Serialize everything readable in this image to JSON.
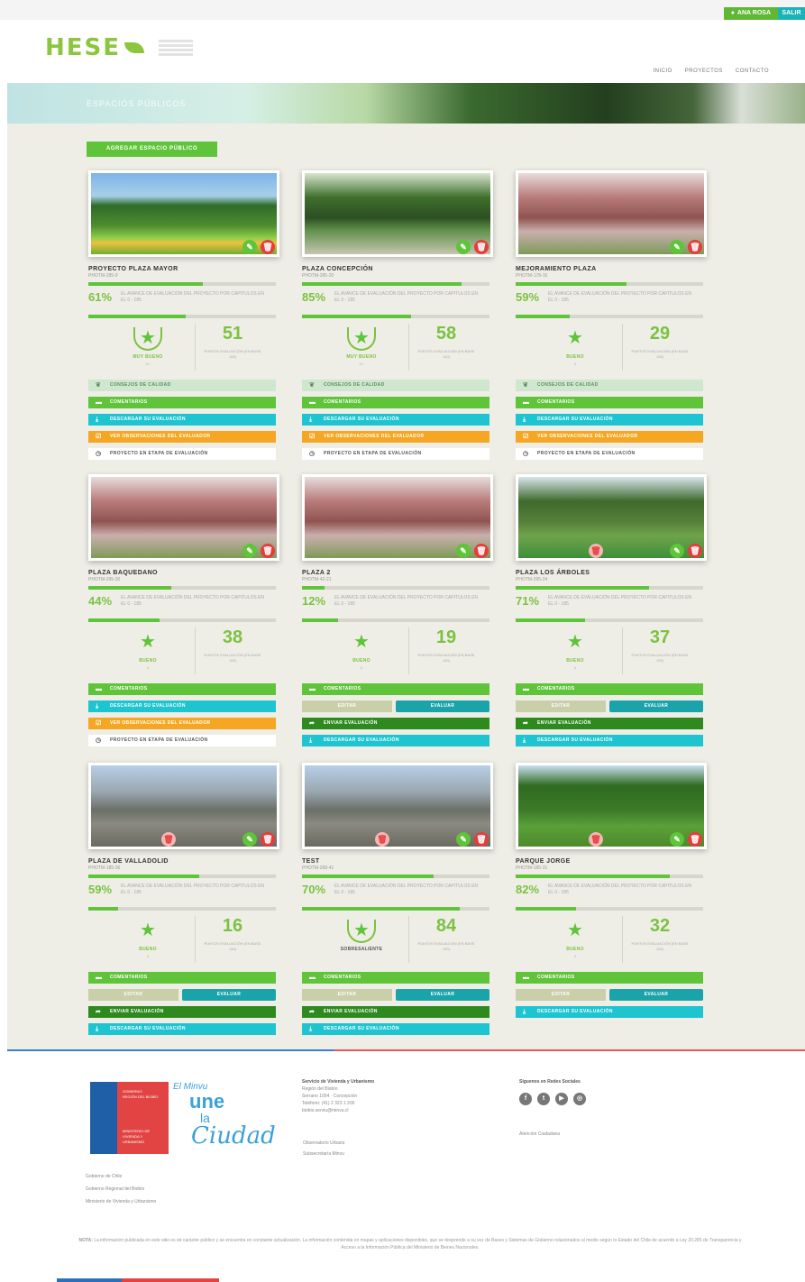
{
  "topbar": {
    "user_label": "ANA ROSA",
    "exit_label": "SALIR"
  },
  "header": {
    "logo_text": "HESE",
    "nav": [
      "INICIO",
      "PROYECTOS",
      "CONTACTO"
    ]
  },
  "banner": {
    "title": "ESPACIOS PÚBLICOS"
  },
  "add_button_label": "AGREGAR ESPACIO PÚBLICO",
  "cards": [
    {
      "title": "PROYECTO PLAZA MAYOR",
      "code": "PHOTM-285-9",
      "percent": "61%",
      "progress": 0.61,
      "progress2": 0.52,
      "pct_desc": "EL AVANCE DE EVALUACIÓN DEL PROYECTO POR CAPITULOS EN EL 0 - 185",
      "rating": "MUY BUENO",
      "rating_sub": "A+",
      "score": "51",
      "score_label": "PUNTOS EVALUACIÓN (EN BASE 100)",
      "advice_label": "CONSEJOS DE CALIDAD",
      "comments_label": "COMENTARIOS",
      "download_label": "DESCARGAR SU EVALUACIÓN",
      "observations_label": "VER OBSERVACIONES DEL EVALUADOR",
      "status_label": "PROYECTO EN ETAPA DE EVALUACIÓN"
    },
    {
      "title": "PLAZA CONCEPCIÓN",
      "code": "PHOTM-285-20",
      "percent": "85%",
      "progress": 0.85,
      "progress2": 0.58,
      "pct_desc": "EL AVANCE DE EVALUACIÓN DEL PROYECTO POR CAPITULOS EN EL 0 - 185",
      "rating": "MUY BUENO",
      "rating_sub": "A+",
      "score": "58",
      "score_label": "PUNTOS EVALUACIÓN (EN BASE 100)",
      "advice_label": "CONSEJOS DE CALIDAD",
      "comments_label": "COMENTARIOS",
      "download_label": "DESCARGAR SU EVALUACIÓN",
      "observations_label": "VER OBSERVACIONES DEL EVALUADOR",
      "status_label": "PROYECTO EN ETAPA DE EVALUACIÓN"
    },
    {
      "title": "MEJORAMIENTO PLAZA",
      "code": "PHOTM-178-16",
      "percent": "59%",
      "progress": 0.59,
      "progress2": 0.29,
      "pct_desc": "EL AVANCE DE EVALUACIÓN DEL PROYECTO POR CAPITULOS EN EL 0 - 185",
      "rating": "BUENO",
      "rating_sub": "A",
      "score": "29",
      "score_label": "PUNTOS EVALUACIÓN (EN BASE 100)",
      "advice_label": "CONSEJOS DE CALIDAD",
      "comments_label": "COMENTARIOS",
      "download_label": "DESCARGAR SU EVALUACIÓN",
      "observations_label": "VER OBSERVACIONES DEL EVALUADOR",
      "status_label": "PROYECTO EN ETAPA DE EVALUACIÓN"
    },
    {
      "title": "PLAZA BAQUEDANO",
      "code": "PHOTM-295-30",
      "percent": "44%",
      "progress": 0.44,
      "progress2": 0.38,
      "pct_desc": "EL AVANCE DE EVALUACIÓN DEL PROYECTO POR CAPITULOS EN EL 0 - 185",
      "rating": "BUENO",
      "rating_sub": "A",
      "score": "38",
      "score_label": "PUNTOS EVALUACIÓN (EN BASE 100)",
      "comments_label": "COMENTARIOS",
      "download_label": "DESCARGAR SU EVALUACIÓN",
      "observations_label": "VER OBSERVACIONES DEL EVALUADOR",
      "status_label": "PROYECTO EN ETAPA DE EVALUACIÓN"
    },
    {
      "title": "PLAZA 2",
      "code": "PHOTM-42-21",
      "percent": "12%",
      "progress": 0.12,
      "progress2": 0.19,
      "pct_desc": "EL AVANCE DE EVALUACIÓN DEL PROYECTO POR CAPITULOS EN EL 0 - 185",
      "rating": "BUENO",
      "rating_sub": "A",
      "score": "19",
      "score_label": "PUNTOS EVALUACIÓN (EN BASE 100)",
      "comments_label": "COMENTARIOS",
      "edit_label": "EDITAR",
      "evaluate_label": "EVALUAR",
      "send_label": "ENVIAR EVALUACIÓN",
      "download_label": "DESCARGAR SU EVALUACIÓN"
    },
    {
      "title": "PLAZA LOS ÁRBOLES",
      "code": "PHOTM-295-24",
      "percent": "71%",
      "progress": 0.71,
      "progress2": 0.37,
      "pct_desc": "EL AVANCE DE EVALUACIÓN DEL PROYECTO POR CAPITULOS EN EL 0 - 185",
      "rating": "BUENO",
      "rating_sub": "A",
      "score": "37",
      "score_label": "PUNTOS EVALUACIÓN (EN BASE 100)",
      "comments_label": "COMENTARIOS",
      "edit_label": "EDITAR",
      "evaluate_label": "EVALUAR",
      "send_label": "ENVIAR EVALUACIÓN",
      "download_label": "DESCARGAR SU EVALUACIÓN"
    },
    {
      "title": "PLAZA DE VALLADOLID",
      "code": "PHOTM-185-36",
      "percent": "59%",
      "progress": 0.59,
      "progress2": 0.16,
      "pct_desc": "EL AVANCE DE EVALUACIÓN DEL PROYECTO POR CAPITULOS EN EL 0 - 185",
      "rating": "BUENO",
      "rating_sub": "A",
      "score": "16",
      "score_label": "PUNTOS EVALUACIÓN (EN BASE 100)",
      "comments_label": "COMENTARIOS",
      "edit_label": "EDITAR",
      "evaluate_label": "EVALUAR",
      "send_label": "ENVIAR EVALUACIÓN",
      "download_label": "DESCARGAR SU EVALUACIÓN"
    },
    {
      "title": "TEST",
      "code": "PHOTM-268-41",
      "percent": "70%",
      "progress": 0.7,
      "progress2": 0.84,
      "pct_desc": "EL AVANCE DE EVALUACIÓN DEL PROYECTO POR CAPITULOS EN EL 0 - 185",
      "rating": "SOBRESALIENTE",
      "rating_sub": "",
      "score": "84",
      "score_label": "PUNTOS EVALUACIÓN (EN BASE 100)",
      "comments_label": "COMENTARIOS",
      "edit_label": "EDITAR",
      "evaluate_label": "EVALUAR",
      "send_label": "ENVIAR EVALUACIÓN",
      "download_label": "DESCARGAR SU EVALUACIÓN"
    },
    {
      "title": "PARQUE JORGE",
      "code": "PHOTM-185-31",
      "percent": "82%",
      "progress": 0.82,
      "progress2": 0.32,
      "pct_desc": "EL AVANCE DE EVALUACIÓN DEL PROYECTO POR CAPITULOS EN EL 0 - 185",
      "rating": "BUENO",
      "rating_sub": "A",
      "score": "32",
      "score_label": "PUNTOS EVALUACIÓN (EN BASE 100)",
      "comments_label": "COMENTARIOS",
      "edit_label": "EDITAR",
      "evaluate_label": "EVALUAR",
      "download_label": "DESCARGAR SU EVALUACIÓN"
    }
  ],
  "footer": {
    "gob_lines": [
      "GOBIERNO",
      "REGIÓN DEL BIOBÍO",
      "MINISTERIO DE",
      "VIVIENDA Y",
      "URBANISMO"
    ],
    "une": [
      "El Minvu",
      "une",
      "la",
      "Ciudad"
    ],
    "links_left": [
      "Gobierno de Chile",
      "Gobierno Regional del Biobío",
      "Ministerio de Vivienda y Urbanismo"
    ],
    "contact_title": "Servicio de Vivienda y Urbanismo",
    "contact_lines": [
      "Región del Biobío",
      "Serrano 1054 · Concepción",
      "Teléfono: (41) 2 323 1 200",
      "biobio.serviu@minvu.cl"
    ],
    "contact_links": [
      "Observatorio Urbano",
      "Subsecretaría Minvu"
    ],
    "social_title": "Síguenos en Redes Sociales",
    "social_icons": [
      "f",
      "t",
      "▶",
      "◎"
    ],
    "social_link": "Atención Ciudadana",
    "note_label": "NOTA:",
    "note": "La información publicada en este sitio es de carácter público y se encuentra en constante actualización. La información contenida en mapas y aplicaciones disponibles, que se desprende a su vez de Bases y Sistemas de Gobierno relacionados al medio según lo Estado del Chile de acuerdo a Ley 20.285 de Transparencia y Acceso a la Información Pública del Ministerio de Bienes Nacionales."
  }
}
